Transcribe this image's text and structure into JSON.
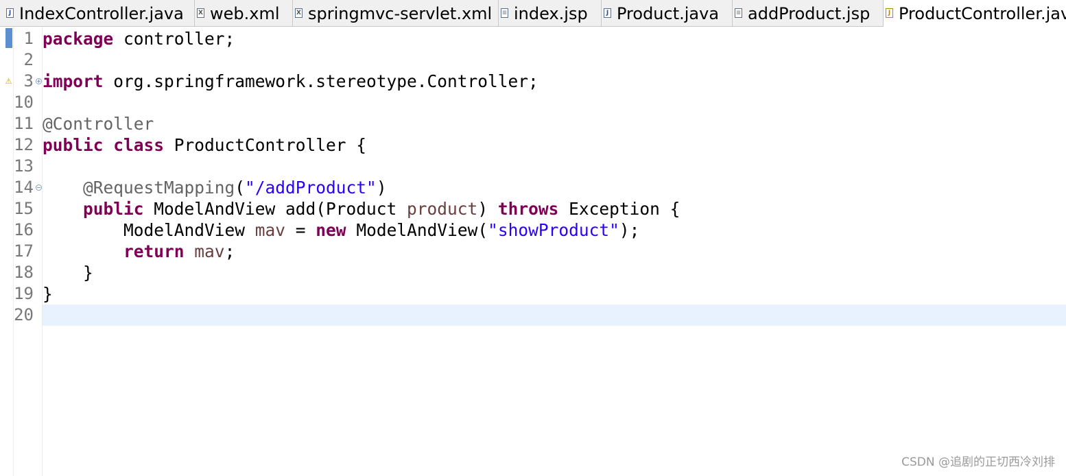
{
  "tabs": [
    {
      "label": "IndexController.java",
      "icon": "java-file-icon",
      "glyph": "J",
      "active": false
    },
    {
      "label": "web.xml",
      "icon": "xml-file-icon",
      "glyph": "X",
      "active": false
    },
    {
      "label": "springmvc-servlet.xml",
      "icon": "xml-file-icon",
      "glyph": "X",
      "active": false
    },
    {
      "label": "index.jsp",
      "icon": "jsp-file-icon",
      "glyph": "≡",
      "active": false
    },
    {
      "label": "Product.java",
      "icon": "java-file-icon",
      "glyph": "J",
      "active": false
    },
    {
      "label": "addProduct.jsp",
      "icon": "jsp-file-icon",
      "glyph": "≡",
      "active": false
    },
    {
      "label": "ProductController.jav",
      "icon": "java-file-warning-icon",
      "glyph": "J",
      "active": true
    }
  ],
  "editor": {
    "current_line": "20",
    "lines": [
      {
        "num": "1",
        "tokens": [
          [
            "kw",
            "package"
          ],
          [
            "plain",
            " controller;"
          ]
        ]
      },
      {
        "num": "2",
        "tokens": []
      },
      {
        "num": "3",
        "fold": "collapsed",
        "warning": true,
        "tokens": [
          [
            "kw",
            "import"
          ],
          [
            "plain",
            " org.springframework.stereotype.Controller;"
          ]
        ]
      },
      {
        "num": "10",
        "tokens": []
      },
      {
        "num": "11",
        "tokens": [
          [
            "ann",
            "@Controller"
          ]
        ]
      },
      {
        "num": "12",
        "tokens": [
          [
            "kw",
            "public"
          ],
          [
            "plain",
            " "
          ],
          [
            "kw",
            "class"
          ],
          [
            "plain",
            " ProductController {"
          ]
        ]
      },
      {
        "num": "13",
        "tokens": []
      },
      {
        "num": "14",
        "fold": "expanded",
        "tokens": [
          [
            "plain",
            "    "
          ],
          [
            "ann",
            "@RequestMapping"
          ],
          [
            "plain",
            "("
          ],
          [
            "str",
            "\"/addProduct\""
          ],
          [
            "plain",
            ")"
          ]
        ]
      },
      {
        "num": "15",
        "tokens": [
          [
            "plain",
            "    "
          ],
          [
            "kw",
            "public"
          ],
          [
            "plain",
            " ModelAndView add(Product "
          ],
          [
            "var",
            "product"
          ],
          [
            "plain",
            ") "
          ],
          [
            "kw",
            "throws"
          ],
          [
            "plain",
            " Exception {"
          ]
        ]
      },
      {
        "num": "16",
        "tokens": [
          [
            "plain",
            "        ModelAndView "
          ],
          [
            "var",
            "mav"
          ],
          [
            "plain",
            " = "
          ],
          [
            "kw",
            "new"
          ],
          [
            "plain",
            " ModelAndView("
          ],
          [
            "str",
            "\"showProduct\""
          ],
          [
            "plain",
            ");"
          ]
        ]
      },
      {
        "num": "17",
        "tokens": [
          [
            "plain",
            "        "
          ],
          [
            "kw",
            "return"
          ],
          [
            "plain",
            " "
          ],
          [
            "var",
            "mav"
          ],
          [
            "plain",
            ";"
          ]
        ]
      },
      {
        "num": "18",
        "tokens": [
          [
            "plain",
            "    }"
          ]
        ]
      },
      {
        "num": "19",
        "tokens": [
          [
            "plain",
            "}"
          ]
        ]
      },
      {
        "num": "20",
        "tokens": []
      }
    ]
  },
  "colors": {
    "keyword": "#7f0055",
    "annotation": "#646464",
    "string": "#2a00ff",
    "local_variable": "#6a3e3e",
    "current_line_highlight": "#e8f2fe",
    "line_number": "#787878"
  },
  "watermark": "CSDN @追剧的正切西冷刘排"
}
